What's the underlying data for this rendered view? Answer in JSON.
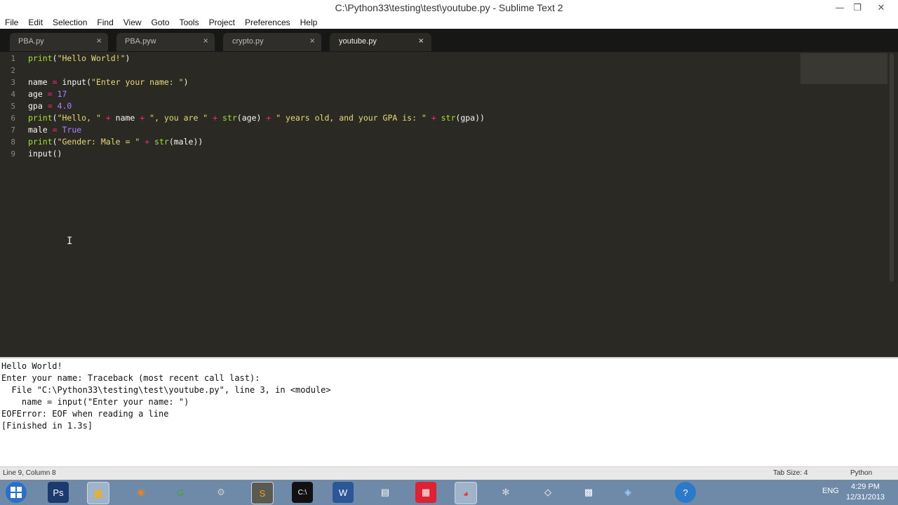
{
  "window": {
    "title": "C:\\Python33\\testing\\test\\youtube.py - Sublime Text 2",
    "min": "—",
    "max": "❐",
    "close": "✕"
  },
  "menu": [
    "File",
    "Edit",
    "Selection",
    "Find",
    "View",
    "Goto",
    "Tools",
    "Project",
    "Preferences",
    "Help"
  ],
  "tabs": [
    {
      "label": "PBA.py",
      "close": "×"
    },
    {
      "label": "PBA.pyw",
      "close": "×"
    },
    {
      "label": "crypto.py",
      "close": "×"
    },
    {
      "label": "youtube.py",
      "close": "×"
    }
  ],
  "gutter": [
    "1",
    "2",
    "3",
    "4",
    "5",
    "6",
    "7",
    "8",
    "9"
  ],
  "code": {
    "l1": {
      "a": "print",
      "b": "(",
      "c": "\"Hello World!\"",
      "d": ")"
    },
    "l3": {
      "a": "name ",
      "b": "=",
      "c": " input(",
      "d": "\"Enter your name: \"",
      "e": ")"
    },
    "l4": {
      "a": "age ",
      "b": "=",
      "c": " ",
      "d": "17"
    },
    "l5": {
      "a": "gpa ",
      "b": "=",
      "c": " ",
      "d": "4.0"
    },
    "l6": {
      "a": "print",
      "b": "(",
      "c": "\"Hello, \"",
      "d": " + ",
      "e": "name",
      "f": " + ",
      "g": "\", you are \"",
      "h": " + ",
      "i": "str",
      "j": "(age)",
      "k": " + ",
      "l": "\" years old, and your GPA is: \"",
      "m": " + ",
      "n": "str",
      "o": "(gpa))"
    },
    "l7": {
      "a": "male ",
      "b": "=",
      "c": " ",
      "d": "True"
    },
    "l8": {
      "a": "print",
      "b": "(",
      "c": "\"Gender: Male = \"",
      "d": " + ",
      "e": "str",
      "f": "(male))"
    },
    "l9": {
      "a": "input",
      "b": "()"
    }
  },
  "console": [
    "Hello World!",
    "Enter your name: Traceback (most recent call last):",
    "  File \"C:\\Python33\\testing\\test\\youtube.py\", line 3, in <module>",
    "    name = input(\"Enter your name: \")",
    "EOFError: EOF when reading a line",
    "[Finished in 1.3s]"
  ],
  "status": {
    "position": "Line 9, Column 8",
    "tab_size": "Tab Size: 4",
    "syntax": "Python"
  },
  "taskbar": {
    "apps": [
      "Start",
      "Ps",
      "Files",
      "Blender",
      "G",
      "Tools",
      "S",
      "C:\\",
      "W",
      "PDF",
      "Office",
      "Chrome",
      "Settings",
      "Unity",
      "Grid",
      "Map"
    ],
    "lang": "ENG",
    "time": "4:29 PM",
    "date": "12/31/2013"
  },
  "colors": {
    "editor_bg": "#2b2924",
    "keyword": "#a6e22e",
    "string": "#e6db74",
    "number": "#ae81ff",
    "operator": "#f92672",
    "taskbar": "#6e8aa8"
  }
}
